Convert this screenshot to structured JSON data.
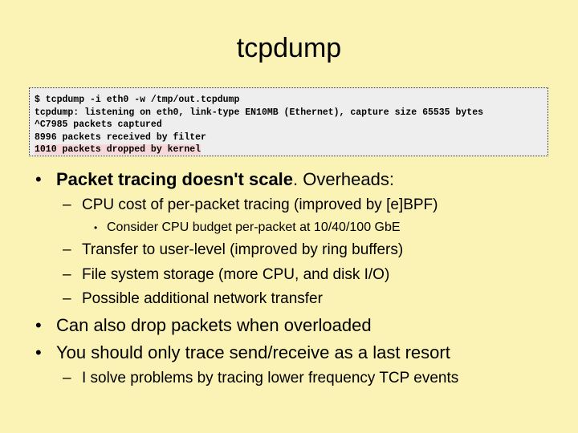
{
  "slide": {
    "title": "tcpdump"
  },
  "terminal": {
    "lines": [
      "$ tcpdump -i eth0 -w /tmp/out.tcpdump",
      "tcpdump: listening on eth0, link-type EN10MB (Ethernet), capture size 65535 bytes",
      "^C7985 packets captured",
      "8996 packets received by filter",
      "1010 packets dropped by kernel"
    ]
  },
  "bullets": {
    "b1_bold": "Packet tracing doesn't scale",
    "b1_rest": ". Overheads:",
    "b1_sub1": "CPU cost of per-packet tracing (improved by [e]BPF)",
    "b1_sub1_sub1": "Consider CPU budget per-packet at 10/40/100 GbE",
    "b1_sub2": "Transfer to user-level (improved by ring buffers)",
    "b1_sub3": "File system storage (more CPU, and disk I/O)",
    "b1_sub4": "Possible additional network transfer",
    "b2": "Can also drop packets when overloaded",
    "b3": "You should only trace send/receive as a last resort",
    "b3_sub1": "I solve problems by tracing lower frequency TCP events"
  },
  "markers": {
    "level1": "•",
    "level2": "–",
    "level3": "•"
  }
}
